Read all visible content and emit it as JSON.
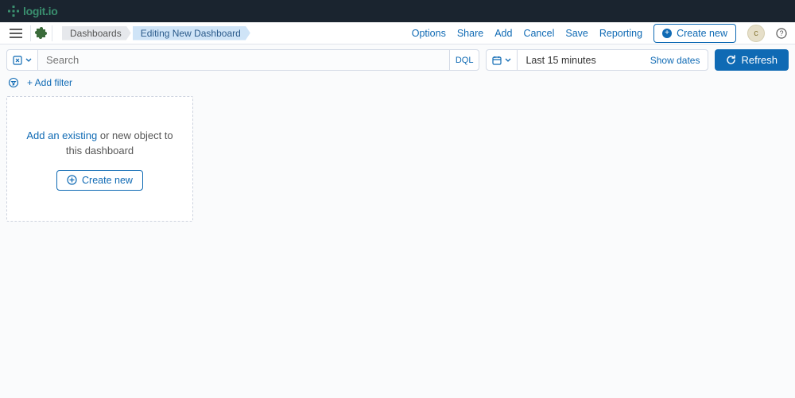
{
  "brand": {
    "name": "logit.io"
  },
  "breadcrumbs": [
    {
      "label": "Dashboards",
      "active": false
    },
    {
      "label": "Editing New Dashboard",
      "active": true
    }
  ],
  "nav": {
    "options": "Options",
    "share": "Share",
    "add": "Add",
    "cancel": "Cancel",
    "save": "Save",
    "reporting": "Reporting",
    "create_new": "Create new",
    "avatar_initial": "c"
  },
  "query": {
    "search_placeholder": "Search",
    "dql": "DQL",
    "time_range": "Last 15 minutes",
    "show_dates": "Show dates",
    "refresh": "Refresh"
  },
  "filters": {
    "add_filter": "+ Add filter"
  },
  "panel": {
    "link_text": "Add an existing",
    "rest_text": " or new object to this dashboard",
    "create_new": "Create new"
  }
}
